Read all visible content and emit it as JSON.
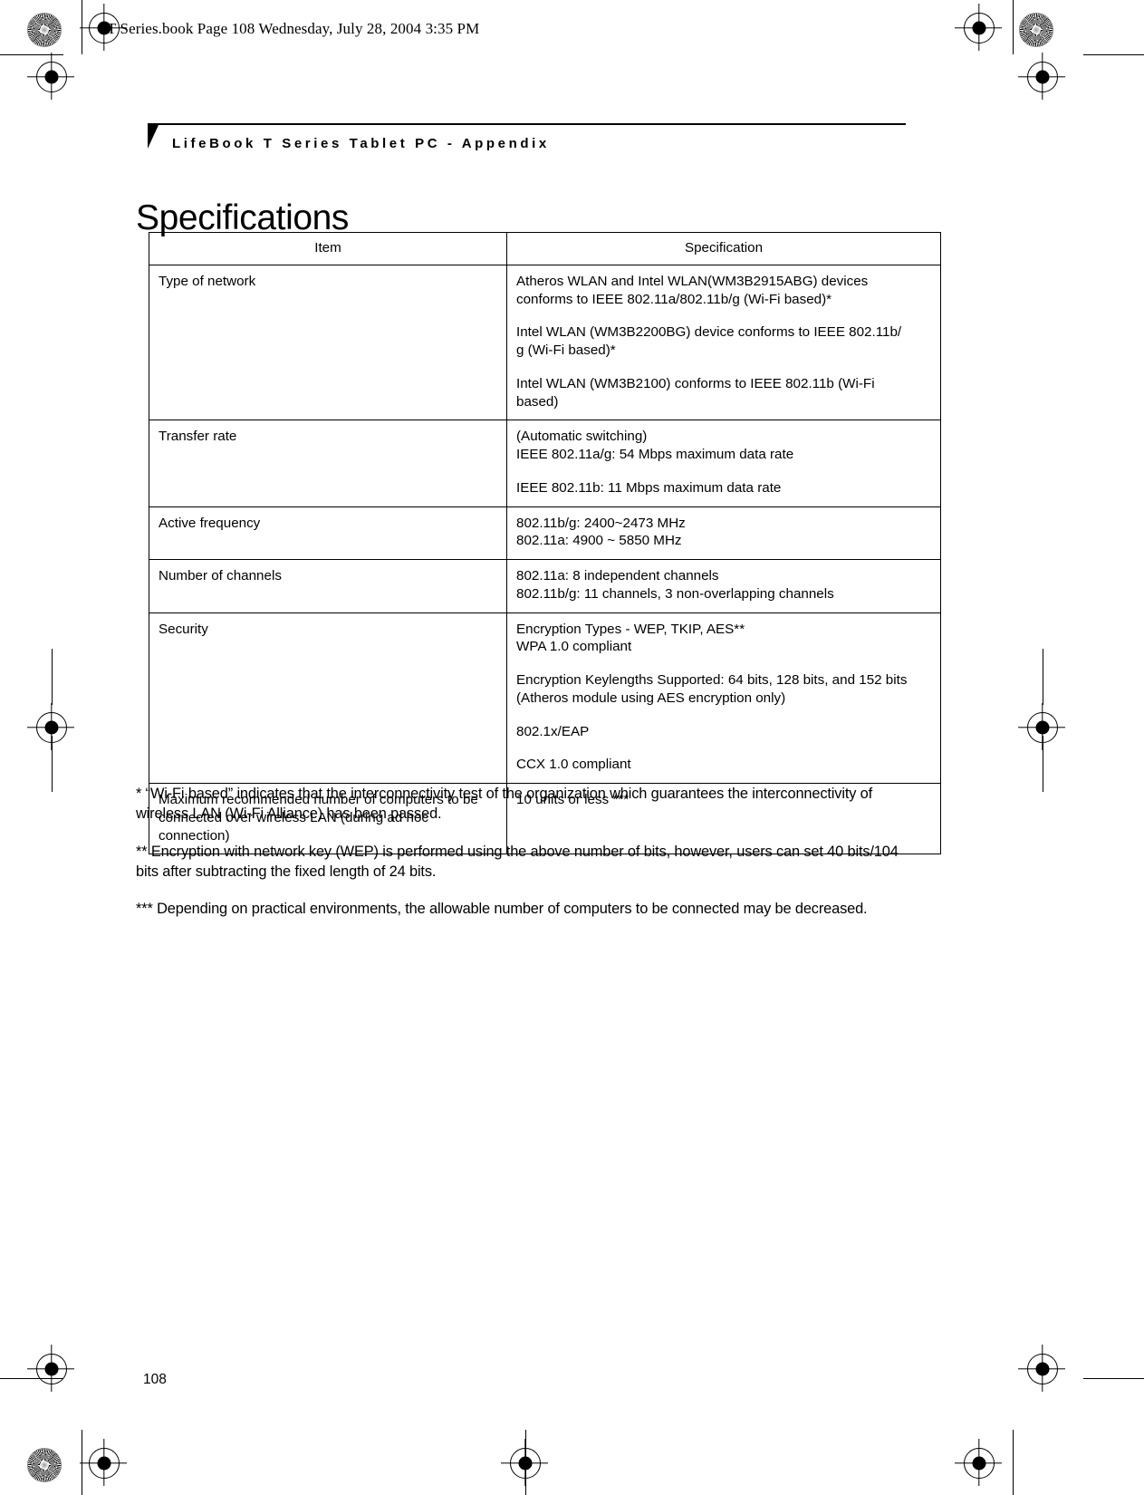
{
  "file_stamp": "T Series.book  Page 108  Wednesday, July 28, 2004  3:35 PM",
  "chapter_head": "LifeBook T Series Tablet PC - Appendix",
  "page_title": "Specifications",
  "folio": "108",
  "table": {
    "headers": {
      "item": "Item",
      "specification": "Specification"
    },
    "rows": [
      {
        "item": "Type of network",
        "spec_paragraphs": [
          [
            "Atheros WLAN and Intel WLAN(WM3B2915ABG) devices",
            "conforms to IEEE 802.11a/802.11b/g (Wi-Fi based)*"
          ],
          [
            "Intel WLAN (WM3B2200BG) device conforms to IEEE 802.11b/",
            "g (Wi-Fi based)*"
          ],
          [
            "Intel WLAN (WM3B2100) conforms to IEEE 802.11b (Wi-Fi",
            "based)"
          ]
        ]
      },
      {
        "item": "Transfer rate",
        "spec_paragraphs": [
          [
            "(Automatic switching)",
            "IEEE 802.11a/g: 54 Mbps maximum data rate"
          ],
          [
            "IEEE 802.11b: 11 Mbps maximum data rate"
          ]
        ]
      },
      {
        "item": "Active frequency",
        "spec_paragraphs": [
          [
            "802.11b/g: 2400~2473 MHz",
            "802.11a: 4900 ~ 5850 MHz"
          ]
        ]
      },
      {
        "item": "Number of channels",
        "spec_paragraphs": [
          [
            "802.11a: 8 independent channels",
            "802.11b/g: 11 channels, 3 non-overlapping channels"
          ]
        ]
      },
      {
        "item": "Security",
        "spec_paragraphs": [
          [
            "Encryption Types - WEP, TKIP, AES**",
            "WPA 1.0 compliant"
          ],
          [
            "Encryption Keylengths Supported: 64 bits, 128 bits, and 152 bits",
            "(Atheros module using AES encryption only)"
          ],
          [
            "802.1x/EAP"
          ],
          [
            "CCX 1.0 compliant"
          ]
        ]
      },
      {
        "item": "Maximum recommended number of computers to be connected over wireless LAN (during ad hoc connection)",
        "spec_paragraphs": [
          [
            "10 units or less ***"
          ]
        ]
      }
    ]
  },
  "footnotes": [
    "* “Wi-Fi based” indicates that the interconnectivity test of the organization which guarantees the interconnectivity of wireless LAN (Wi-Fi Alliance) has been passed.",
    "** Encryption with network key (WEP) is performed using the above number of bits, however, users can set 40 bits/104 bits after subtracting the fixed length of 24 bits.",
    "*** Depending on practical environments, the allowable number of computers to be connected may be decreased."
  ]
}
